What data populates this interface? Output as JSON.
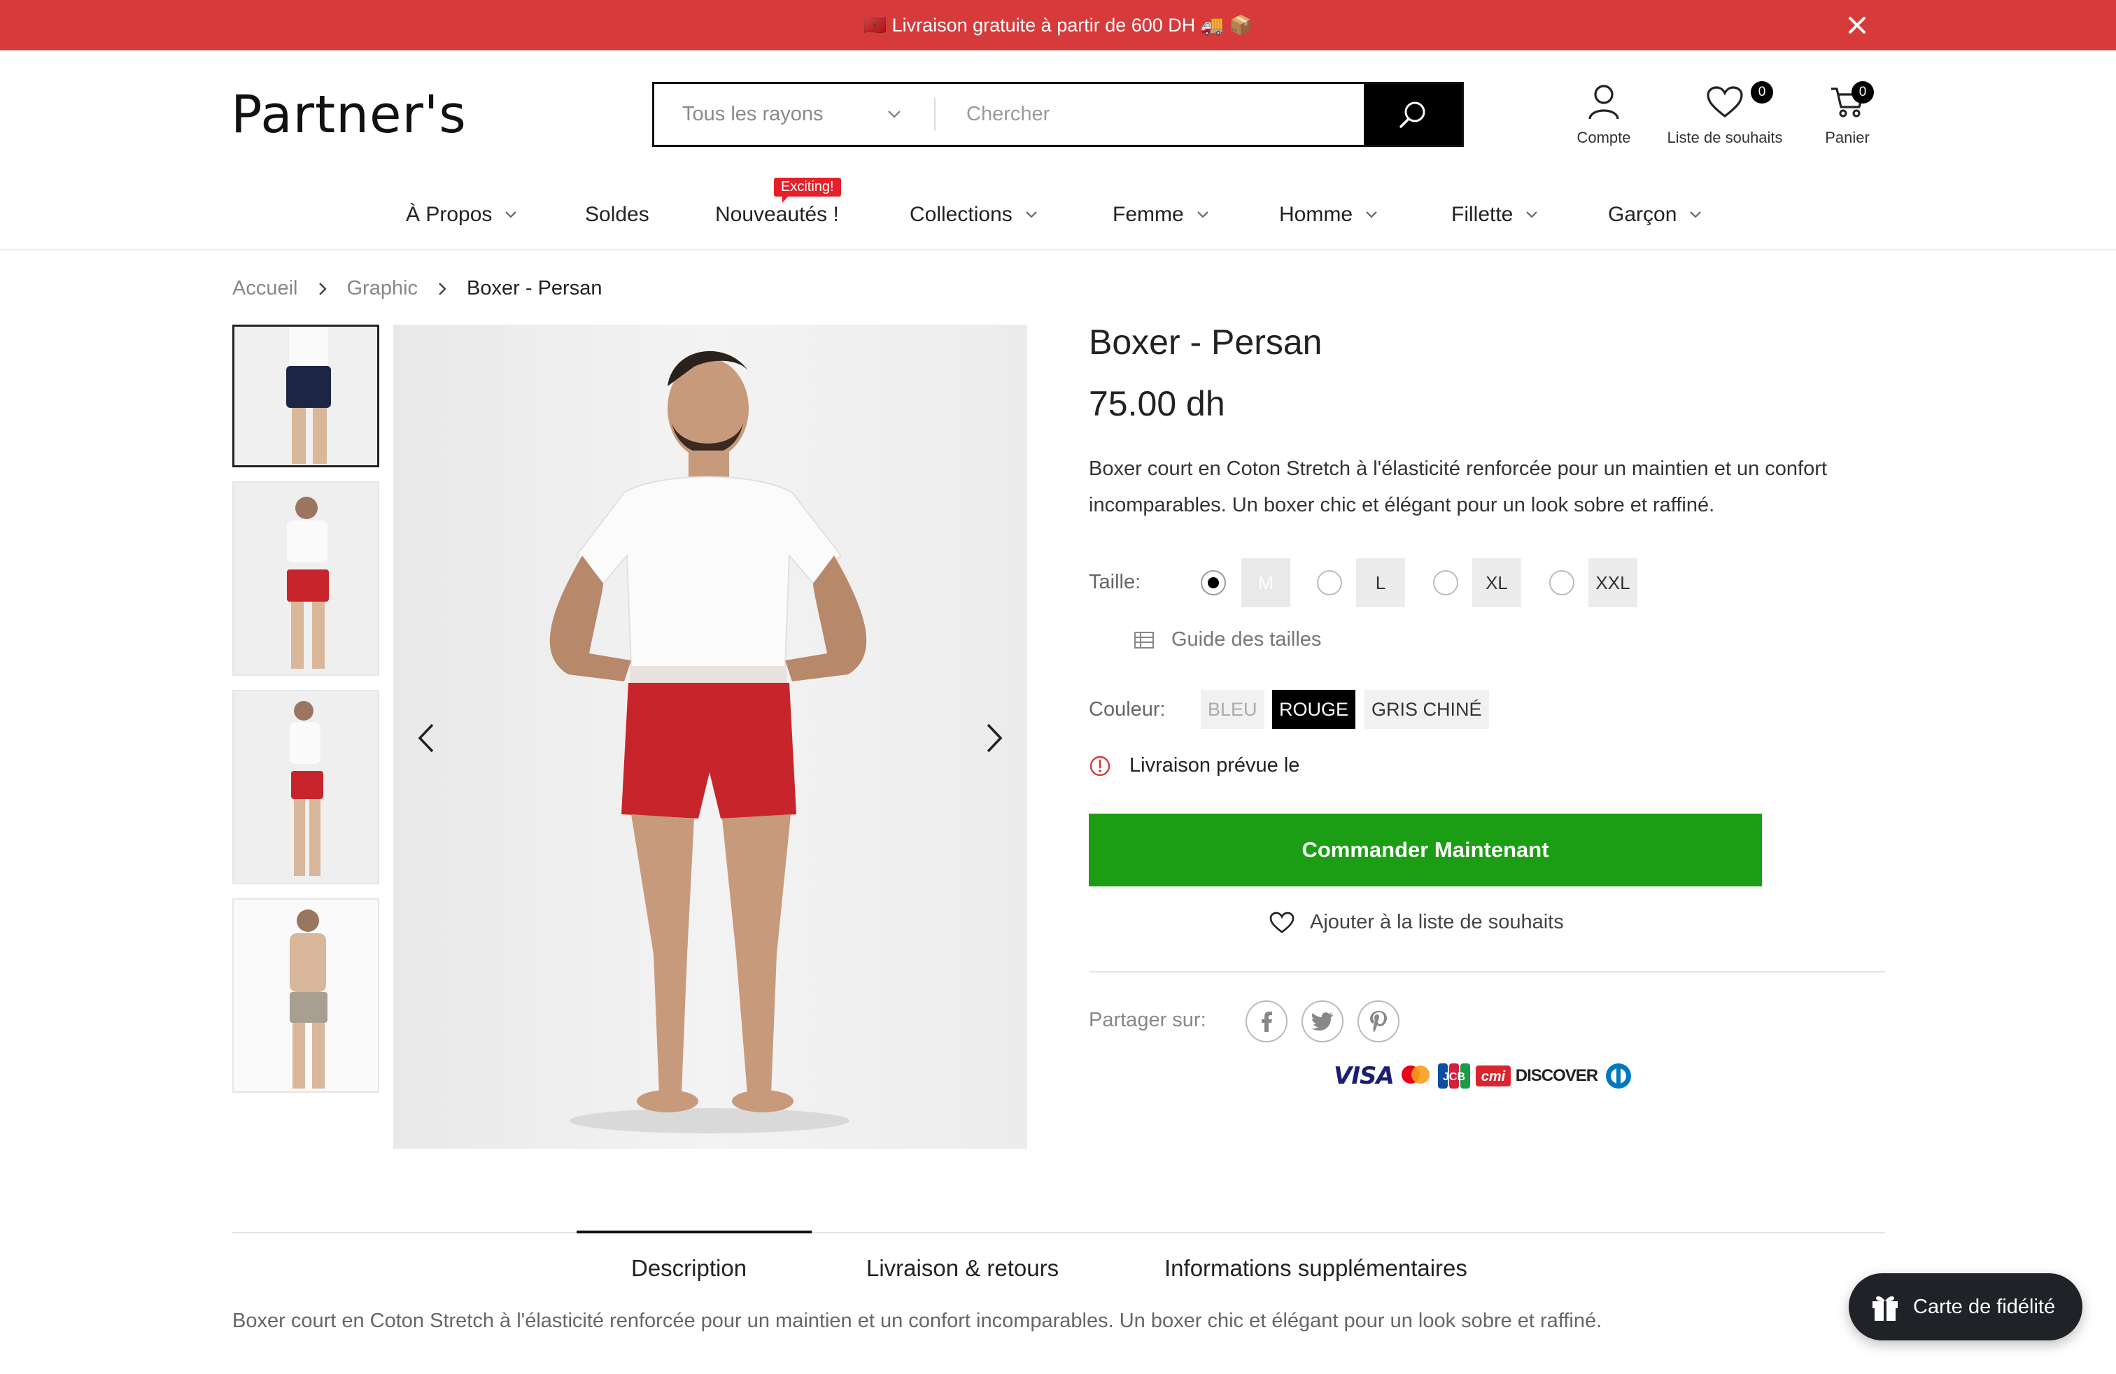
{
  "announcement": {
    "text": "🇲🇦 Livraison gratuite à partir de 600 DH 🚚 📦"
  },
  "header": {
    "logo": "Partner's",
    "search": {
      "department": "Tous les rayons",
      "placeholder": "Chercher"
    },
    "account_label": "Compte",
    "wishlist_label": "Liste de souhaits",
    "wishlist_count": "0",
    "cart_label": "Panier",
    "cart_count": "0"
  },
  "nav": {
    "items": [
      "À Propos",
      "Soldes",
      "Nouveautés !",
      "Collections",
      "Femme",
      "Homme",
      "Fillette",
      "Garçon"
    ],
    "badge": "Exciting!"
  },
  "breadcrumb": [
    "Accueil",
    "Graphic",
    "Boxer - Persan"
  ],
  "product": {
    "title": "Boxer - Persan",
    "price": "75.00 dh",
    "description": "Boxer court en Coton Stretch à l'élasticité renforcée pour un maintien et un confort incomparables. Un boxer chic et élégant pour un look sobre et raffiné.",
    "size_label": "Taille:",
    "sizes": [
      "M",
      "L",
      "XL",
      "XXL"
    ],
    "selected_size": "M",
    "size_guide": "Guide des tailles",
    "color_label": "Couleur:",
    "colors": [
      "BLEU",
      "ROUGE",
      "GRIS CHINÉ"
    ],
    "selected_color": "ROUGE",
    "delivery": "Livraison prévue le",
    "cta": "Commander Maintenant",
    "wishlist": "Ajouter à la liste de souhaits",
    "share_label": "Partager sur:",
    "payment": [
      "VISA",
      "Mastercard",
      "JCB",
      "cmi",
      "DISCOVER",
      "Diners Club"
    ],
    "thumb_colors": [
      "#1c2644",
      "#c8242b",
      "#c8242b",
      "#a89e92"
    ]
  },
  "tabs": {
    "items": [
      "Description",
      "Livraison & retours",
      "Informations supplémentaires"
    ],
    "active": "Description",
    "content": "Boxer court en Coton Stretch à l'élasticité renforcée pour un maintien et un confort incomparables. Un boxer chic et élégant pour un look sobre et raffiné."
  },
  "loyalty": {
    "label": "Carte de fidélité"
  },
  "colors": {
    "announcement_bg": "#d63a3a",
    "cta_bg": "#1b9e13",
    "accent_badge": "#e5202a",
    "loyalty_bg": "#1f2226"
  }
}
